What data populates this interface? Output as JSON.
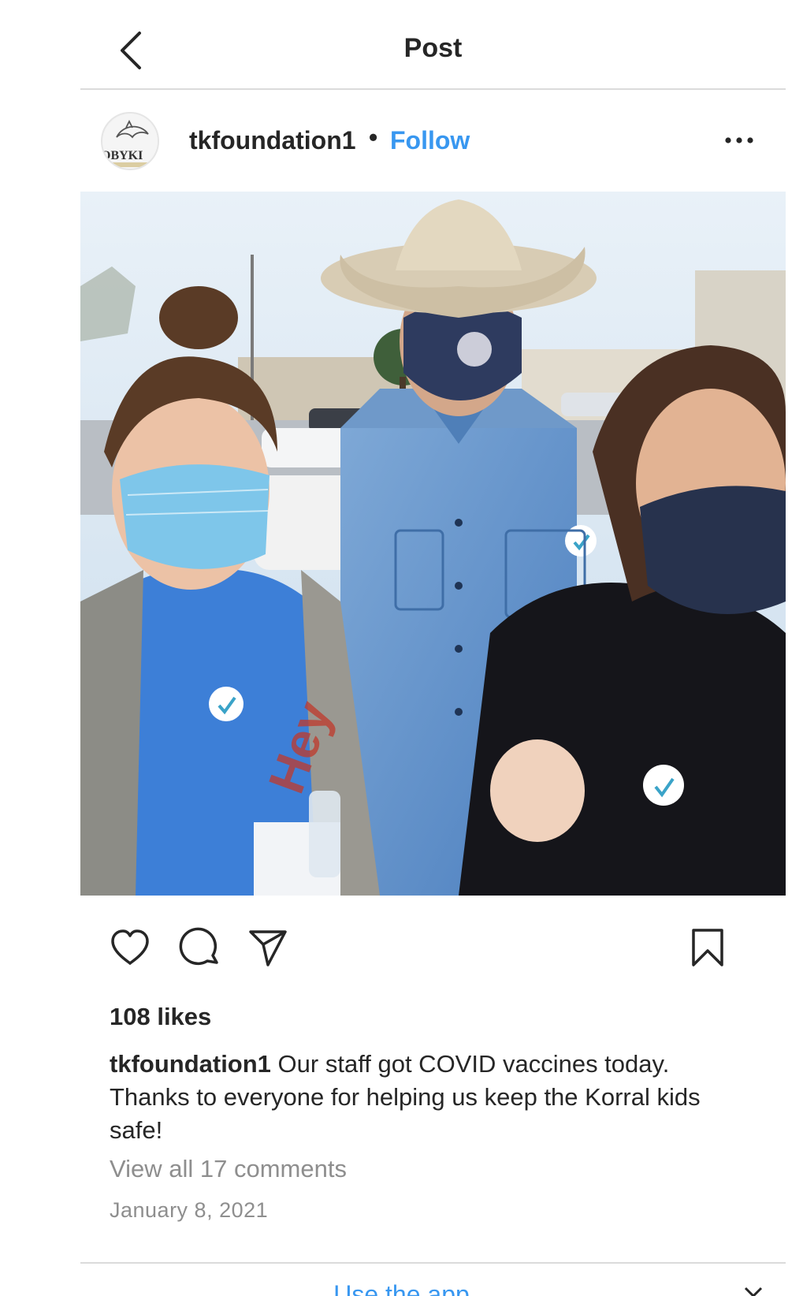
{
  "header": {
    "title": "Post"
  },
  "post": {
    "author": {
      "username": "tkfoundation1",
      "separator": "•",
      "follow_label": "Follow",
      "avatar_text": "OBYKI"
    },
    "likes": "108 likes",
    "caption": {
      "username": "tkfoundation1",
      "text": "Our staff got COVID vaccines today. Thanks to everyone for helping us keep the Korral kids safe!"
    },
    "comments_link": "View all 17 comments",
    "date": "January 8, 2021"
  },
  "banner": {
    "use_app_label": "Use the app"
  },
  "icons": {
    "back": "chevron-left-icon",
    "more": "more-horizontal-icon",
    "like": "heart-icon",
    "comment": "comment-icon",
    "share": "send-icon",
    "save": "bookmark-icon",
    "close": "close-icon"
  },
  "colors": {
    "link_blue": "#3897f0",
    "text_primary": "#262626",
    "text_secondary": "#8e8e8e",
    "divider": "#dbdbdb"
  }
}
